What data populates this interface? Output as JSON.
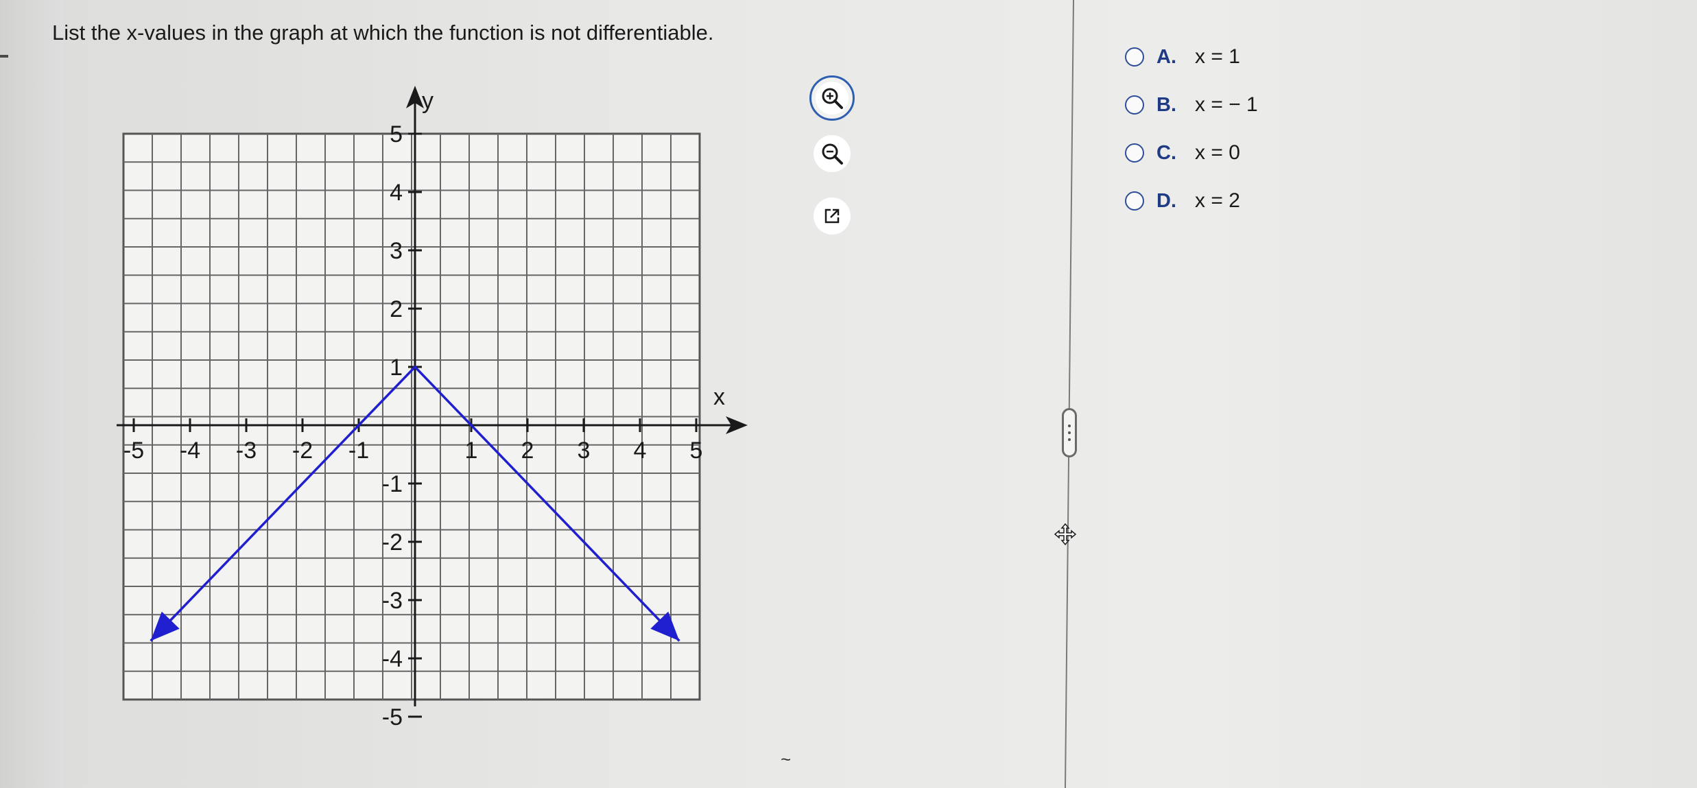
{
  "question": "List the x-values in the graph at which the function is not differentiable.",
  "tools": {
    "zoom_in_icon": "zoom-in-icon",
    "zoom_out_icon": "zoom-out-icon",
    "popout_icon": "external-window-icon"
  },
  "options": [
    {
      "letter": "A.",
      "text": "x = 1"
    },
    {
      "letter": "B.",
      "text": "x = − 1"
    },
    {
      "letter": "C.",
      "text": "x = 0"
    },
    {
      "letter": "D.",
      "text": "x = 2"
    }
  ],
  "squiggle": "~",
  "colors": {
    "curve": "#1f1fcf",
    "option_letter": "#1f3b85",
    "zoom_ring": "#2f5fb0"
  },
  "chart_data": {
    "type": "line",
    "xlabel": "x",
    "ylabel": "y",
    "xlim": [
      -5,
      5
    ],
    "ylim": [
      -5,
      5
    ],
    "grid": true,
    "x_ticks": [
      "-5",
      "-4",
      "-3",
      "-2",
      "-1",
      "1",
      "2",
      "3",
      "4",
      "5"
    ],
    "y_ticks": [
      "5",
      "4",
      "3",
      "2",
      "1",
      "-1",
      "-2",
      "-3",
      "-4",
      "-5"
    ],
    "series": [
      {
        "points": [
          [
            -4.7,
            -3.7
          ],
          [
            0,
            1
          ],
          [
            4.7,
            -3.7
          ]
        ],
        "arrow_start": true,
        "arrow_end": true
      }
    ]
  }
}
